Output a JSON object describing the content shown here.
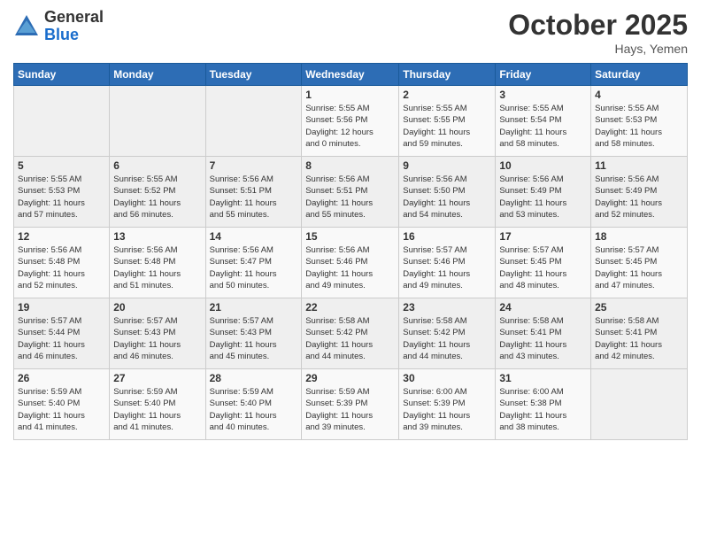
{
  "header": {
    "logo": {
      "general": "General",
      "blue": "Blue"
    },
    "title": "October 2025",
    "location": "Hays, Yemen"
  },
  "weekdays": [
    "Sunday",
    "Monday",
    "Tuesday",
    "Wednesday",
    "Thursday",
    "Friday",
    "Saturday"
  ],
  "weeks": [
    [
      {
        "day": "",
        "info": ""
      },
      {
        "day": "",
        "info": ""
      },
      {
        "day": "",
        "info": ""
      },
      {
        "day": "1",
        "info": "Sunrise: 5:55 AM\nSunset: 5:56 PM\nDaylight: 12 hours\nand 0 minutes."
      },
      {
        "day": "2",
        "info": "Sunrise: 5:55 AM\nSunset: 5:55 PM\nDaylight: 11 hours\nand 59 minutes."
      },
      {
        "day": "3",
        "info": "Sunrise: 5:55 AM\nSunset: 5:54 PM\nDaylight: 11 hours\nand 58 minutes."
      },
      {
        "day": "4",
        "info": "Sunrise: 5:55 AM\nSunset: 5:53 PM\nDaylight: 11 hours\nand 58 minutes."
      }
    ],
    [
      {
        "day": "5",
        "info": "Sunrise: 5:55 AM\nSunset: 5:53 PM\nDaylight: 11 hours\nand 57 minutes."
      },
      {
        "day": "6",
        "info": "Sunrise: 5:55 AM\nSunset: 5:52 PM\nDaylight: 11 hours\nand 56 minutes."
      },
      {
        "day": "7",
        "info": "Sunrise: 5:56 AM\nSunset: 5:51 PM\nDaylight: 11 hours\nand 55 minutes."
      },
      {
        "day": "8",
        "info": "Sunrise: 5:56 AM\nSunset: 5:51 PM\nDaylight: 11 hours\nand 55 minutes."
      },
      {
        "day": "9",
        "info": "Sunrise: 5:56 AM\nSunset: 5:50 PM\nDaylight: 11 hours\nand 54 minutes."
      },
      {
        "day": "10",
        "info": "Sunrise: 5:56 AM\nSunset: 5:49 PM\nDaylight: 11 hours\nand 53 minutes."
      },
      {
        "day": "11",
        "info": "Sunrise: 5:56 AM\nSunset: 5:49 PM\nDaylight: 11 hours\nand 52 minutes."
      }
    ],
    [
      {
        "day": "12",
        "info": "Sunrise: 5:56 AM\nSunset: 5:48 PM\nDaylight: 11 hours\nand 52 minutes."
      },
      {
        "day": "13",
        "info": "Sunrise: 5:56 AM\nSunset: 5:48 PM\nDaylight: 11 hours\nand 51 minutes."
      },
      {
        "day": "14",
        "info": "Sunrise: 5:56 AM\nSunset: 5:47 PM\nDaylight: 11 hours\nand 50 minutes."
      },
      {
        "day": "15",
        "info": "Sunrise: 5:56 AM\nSunset: 5:46 PM\nDaylight: 11 hours\nand 49 minutes."
      },
      {
        "day": "16",
        "info": "Sunrise: 5:57 AM\nSunset: 5:46 PM\nDaylight: 11 hours\nand 49 minutes."
      },
      {
        "day": "17",
        "info": "Sunrise: 5:57 AM\nSunset: 5:45 PM\nDaylight: 11 hours\nand 48 minutes."
      },
      {
        "day": "18",
        "info": "Sunrise: 5:57 AM\nSunset: 5:45 PM\nDaylight: 11 hours\nand 47 minutes."
      }
    ],
    [
      {
        "day": "19",
        "info": "Sunrise: 5:57 AM\nSunset: 5:44 PM\nDaylight: 11 hours\nand 46 minutes."
      },
      {
        "day": "20",
        "info": "Sunrise: 5:57 AM\nSunset: 5:43 PM\nDaylight: 11 hours\nand 46 minutes."
      },
      {
        "day": "21",
        "info": "Sunrise: 5:57 AM\nSunset: 5:43 PM\nDaylight: 11 hours\nand 45 minutes."
      },
      {
        "day": "22",
        "info": "Sunrise: 5:58 AM\nSunset: 5:42 PM\nDaylight: 11 hours\nand 44 minutes."
      },
      {
        "day": "23",
        "info": "Sunrise: 5:58 AM\nSunset: 5:42 PM\nDaylight: 11 hours\nand 44 minutes."
      },
      {
        "day": "24",
        "info": "Sunrise: 5:58 AM\nSunset: 5:41 PM\nDaylight: 11 hours\nand 43 minutes."
      },
      {
        "day": "25",
        "info": "Sunrise: 5:58 AM\nSunset: 5:41 PM\nDaylight: 11 hours\nand 42 minutes."
      }
    ],
    [
      {
        "day": "26",
        "info": "Sunrise: 5:59 AM\nSunset: 5:40 PM\nDaylight: 11 hours\nand 41 minutes."
      },
      {
        "day": "27",
        "info": "Sunrise: 5:59 AM\nSunset: 5:40 PM\nDaylight: 11 hours\nand 41 minutes."
      },
      {
        "day": "28",
        "info": "Sunrise: 5:59 AM\nSunset: 5:40 PM\nDaylight: 11 hours\nand 40 minutes."
      },
      {
        "day": "29",
        "info": "Sunrise: 5:59 AM\nSunset: 5:39 PM\nDaylight: 11 hours\nand 39 minutes."
      },
      {
        "day": "30",
        "info": "Sunrise: 6:00 AM\nSunset: 5:39 PM\nDaylight: 11 hours\nand 39 minutes."
      },
      {
        "day": "31",
        "info": "Sunrise: 6:00 AM\nSunset: 5:38 PM\nDaylight: 11 hours\nand 38 minutes."
      },
      {
        "day": "",
        "info": ""
      }
    ]
  ]
}
